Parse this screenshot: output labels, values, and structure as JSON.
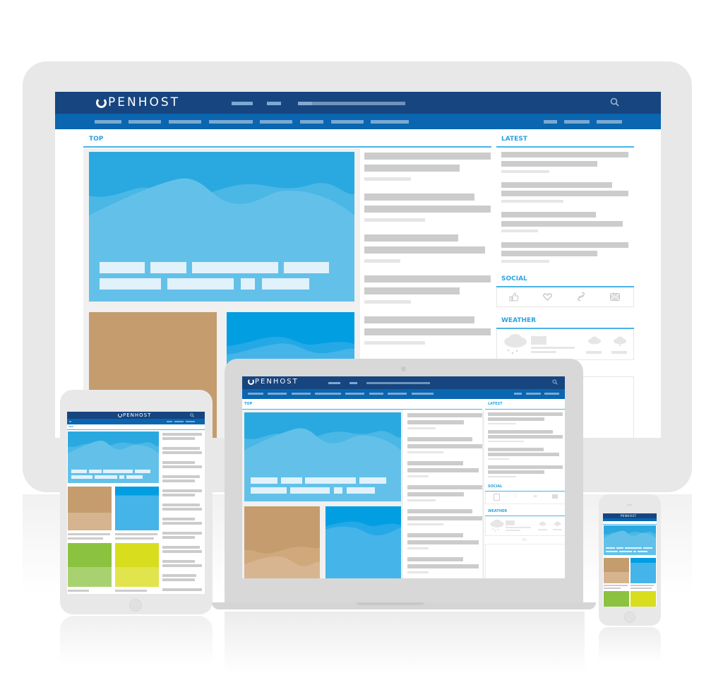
{
  "brand": {
    "name": "PENHOST",
    "logo_icon": "power-ring-icon"
  },
  "colors": {
    "header_dark": "#17457f",
    "nav_blue": "#0a66b0",
    "accent": "#29a3e0",
    "hero_blue": "#2aa9e0",
    "tan": "#c49c6e",
    "green": "#8bc23f",
    "yellow": "#d8dd1e",
    "device_frame": "#e6e6e6",
    "placeholder": "#cccccc"
  },
  "monitor": {
    "sections": {
      "top": "TOP",
      "latest": "LATEST",
      "social": "SOCIAL",
      "weather": "WEATHER"
    },
    "social_icons": [
      "thumbs-up-icon",
      "heart-icon",
      "link-icon",
      "mail-icon"
    ],
    "search_icon": "search-icon"
  },
  "laptop": {
    "sections": {
      "top": "TOP",
      "latest": "LATEST",
      "social": "SOCIAL",
      "weather": "WEATHER",
      "ad": "AD"
    }
  },
  "tablet": {
    "sections": {
      "top": "TOP"
    }
  },
  "phone": {}
}
